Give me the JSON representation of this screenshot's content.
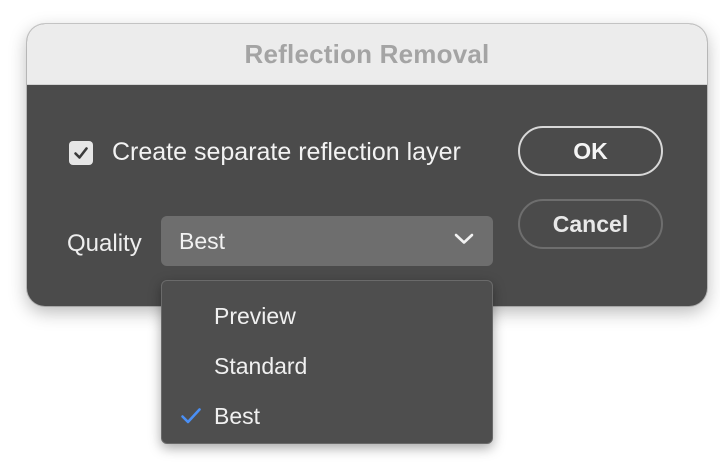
{
  "dialog": {
    "title": "Reflection Removal"
  },
  "options": {
    "checkbox_label": "Create separate reflection layer",
    "checkbox_checked": true
  },
  "buttons": {
    "ok_label": "OK",
    "cancel_label": "Cancel"
  },
  "quality": {
    "label": "Quality",
    "selected": "Best",
    "options": [
      {
        "label": "Preview",
        "selected": false
      },
      {
        "label": "Standard",
        "selected": false
      },
      {
        "label": "Best",
        "selected": true
      }
    ]
  },
  "colors": {
    "dialog_bg": "#4b4b4b",
    "titlebar_bg": "#ececec",
    "accent_check": "#4a8ff5"
  }
}
